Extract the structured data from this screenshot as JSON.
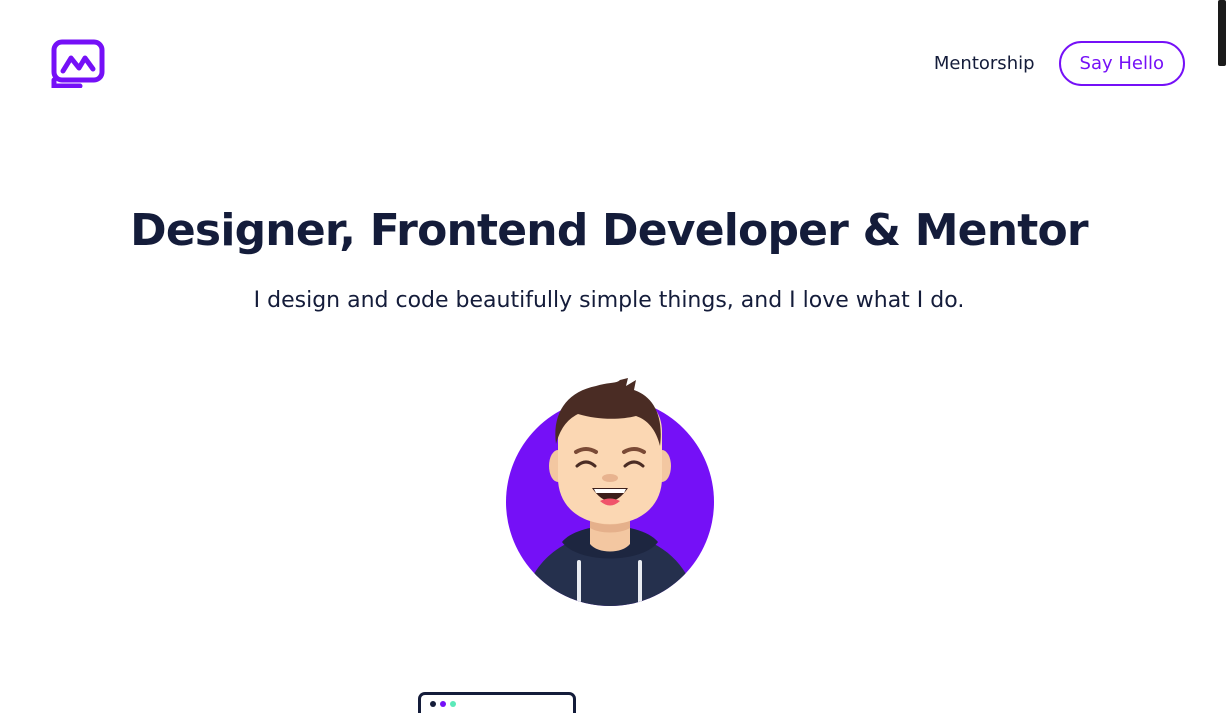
{
  "header": {
    "logo_icon": "mf-monogram-logo",
    "nav_link": "Mentorship",
    "cta": "Say Hello"
  },
  "hero": {
    "title": "Designer, Frontend Developer & Mentor",
    "subtitle": "I design and code beautifully simple things, and I love what I do."
  },
  "avatar": {
    "icon": "smiling-man-avatar"
  },
  "device_icon": "browser-window-icon",
  "colors": {
    "accent": "#7510f7",
    "text": "#141c3a",
    "dot1": "#141c3a",
    "dot2": "#7510f7",
    "dot3": "#5be9b9"
  }
}
